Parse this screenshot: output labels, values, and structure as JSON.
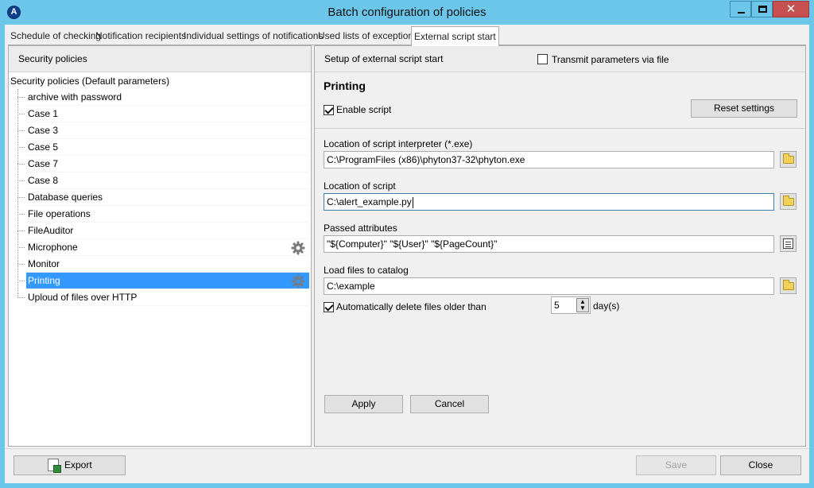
{
  "window": {
    "title": "Batch configuration of policies",
    "app_icon_letter": "A",
    "minimize": "",
    "close_glyph": "✕"
  },
  "tabs": [
    {
      "label": "Schedule of checking",
      "active": false
    },
    {
      "label": "Notification recipients",
      "active": false
    },
    {
      "label": "Individual settings of notifications",
      "active": false
    },
    {
      "label": "Used lists of exceptions",
      "active": false
    },
    {
      "label": "External script start",
      "active": true
    }
  ],
  "left_panel": {
    "header": "Security policies",
    "root": "Security policies (Default parameters)",
    "items": [
      {
        "label": "archive with password",
        "gear": false,
        "selected": false
      },
      {
        "label": "Case 1",
        "gear": false,
        "selected": false
      },
      {
        "label": "Case 3",
        "gear": false,
        "selected": false
      },
      {
        "label": "Case 5",
        "gear": false,
        "selected": false
      },
      {
        "label": "Case 7",
        "gear": false,
        "selected": false
      },
      {
        "label": "Case 8",
        "gear": false,
        "selected": false
      },
      {
        "label": "Database queries",
        "gear": false,
        "selected": false
      },
      {
        "label": "File operations",
        "gear": false,
        "selected": false
      },
      {
        "label": "FileAuditor",
        "gear": false,
        "selected": false
      },
      {
        "label": "Microphone",
        "gear": true,
        "selected": false
      },
      {
        "label": "Monitor",
        "gear": false,
        "selected": false
      },
      {
        "label": "Printing",
        "gear": true,
        "selected": true
      },
      {
        "label": "Uploud of files over HTTP",
        "gear": false,
        "selected": false
      }
    ]
  },
  "right_panel": {
    "header": "Setup of external script start",
    "transmit_via_file": {
      "label": "Transmit parameters via file",
      "checked": false
    },
    "section_title": "Printing",
    "enable_script": {
      "label": "Enable script",
      "checked": true
    },
    "reset_button": "Reset settings",
    "interpreter": {
      "label": "Location of script interpreter (*.exe)",
      "value": "C:\\ProgramFiles (x86)\\phyton37-32\\phyton.exe"
    },
    "script": {
      "label": "Location of script",
      "value": "C:\\alert_example.py"
    },
    "attributes": {
      "label": "Passed attributes",
      "value": "\"${Computer}\" \"${User}\" \"${PageCount}\""
    },
    "catalog": {
      "label": "Load files to catalog",
      "value": "C:\\example"
    },
    "auto_delete": {
      "label": "Automatically delete files older than",
      "checked": true,
      "days": "5",
      "unit": "day(s)"
    },
    "apply_button": "Apply",
    "cancel_button": "Cancel"
  },
  "footer": {
    "export_button": "Export",
    "save_button": "Save",
    "close_button": "Close"
  }
}
